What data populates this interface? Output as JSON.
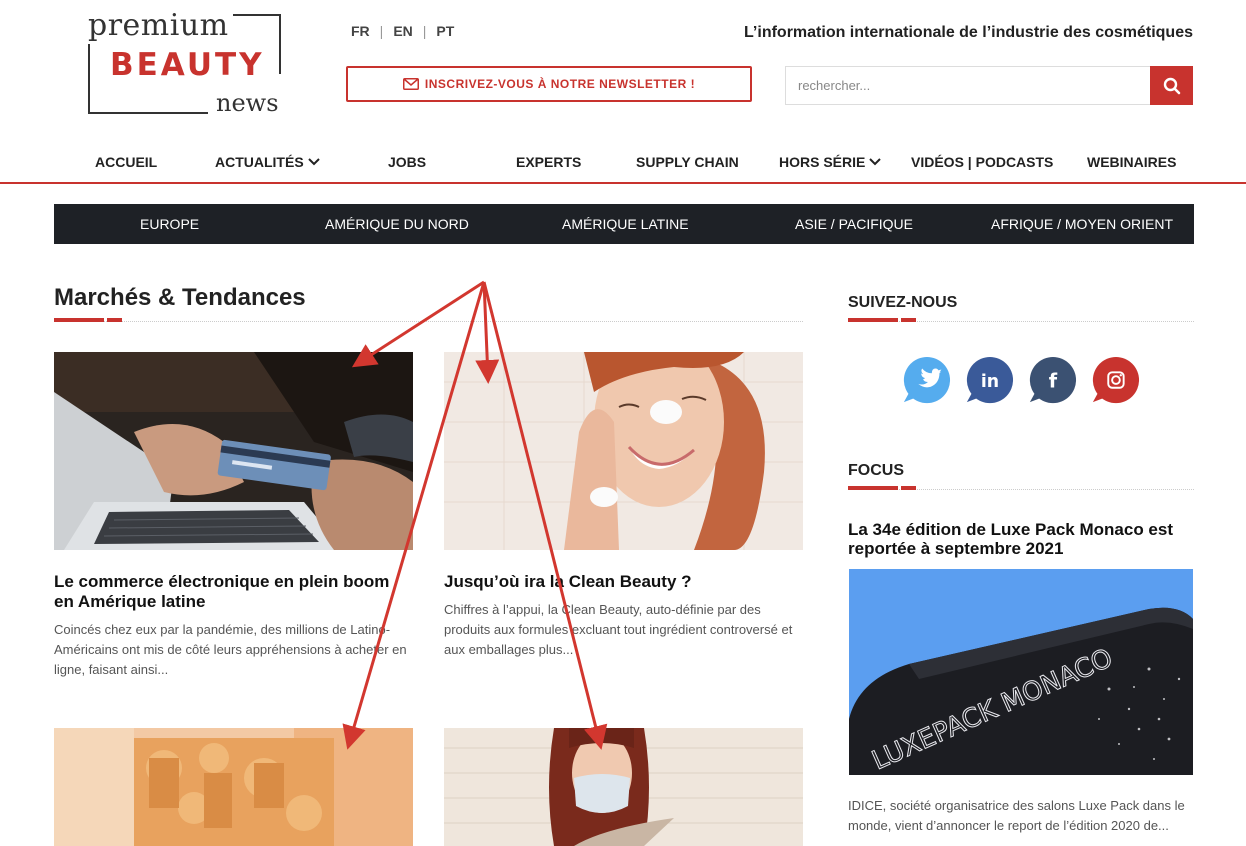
{
  "logo": {
    "line1": "premium",
    "line2": "BEAUTY",
    "line3": "news"
  },
  "languages": [
    "FR",
    "EN",
    "PT"
  ],
  "tagline": "L’information internationale de l’industrie des cosmétiques",
  "newsletter": {
    "label": "INSCRIVEZ-VOUS À NOTRE NEWSLETTER !",
    "icon": "envelope-icon"
  },
  "search": {
    "placeholder": "rechercher...",
    "icon": "search-icon"
  },
  "nav": {
    "items": [
      {
        "label": "ACCUEIL"
      },
      {
        "label": "ACTUALITÉS",
        "dropdown": true
      },
      {
        "label": "JOBS"
      },
      {
        "label": "EXPERTS"
      },
      {
        "label": "SUPPLY CHAIN"
      },
      {
        "label": "HORS SÉRIE",
        "dropdown": true
      },
      {
        "label": "VIDÉOS | PODCASTS"
      },
      {
        "label": "WEBINAIRES"
      }
    ]
  },
  "regions": [
    "EUROPE",
    "AMÉRIQUE DU NORD",
    "AMÉRIQUE LATINE",
    "ASIE / PACIFIQUE",
    "AFRIQUE / MOYEN ORIENT"
  ],
  "main": {
    "title": "Marchés & Tendances",
    "articles": [
      {
        "title": "Le commerce électronique en plein boom en Amérique latine",
        "excerpt": "Coincés chez eux par la pandémie, des millions de Latino-Américains ont mis de côté leurs appréhensions à acheter en ligne, faisant ainsi..."
      },
      {
        "title": "Jusqu’où ira la Clean Beauty ?",
        "excerpt": "Chiffres à l’appui, la Clean Beauty, auto-définie par des produits aux formules excluant tout ingrédient controversé et aux emballages plus..."
      }
    ]
  },
  "sidebar": {
    "follow_title": "SUIVEZ-NOUS",
    "social": [
      {
        "icon": "twitter-icon",
        "color": "#55acee"
      },
      {
        "icon": "linkedin-icon",
        "color": "#3a5a99"
      },
      {
        "icon": "facebook-icon",
        "color": "#3b5172"
      },
      {
        "icon": "instagram-icon",
        "color": "#c8332e"
      }
    ],
    "focus_title": "FOCUS",
    "focus_article": {
      "title": "La 34e édition de Luxe Pack Monaco est reportée à septembre 2021",
      "image_text": "LUXEPACK MONACO",
      "excerpt": "IDICE, société organisatrice des salons Luxe Pack dans le monde, vient d’annoncer le report de l’édition 2020 de..."
    }
  },
  "colors": {
    "accent": "#c8332e",
    "dark_bar": "#1e2126",
    "annotation_arrow": "#d2372f"
  }
}
